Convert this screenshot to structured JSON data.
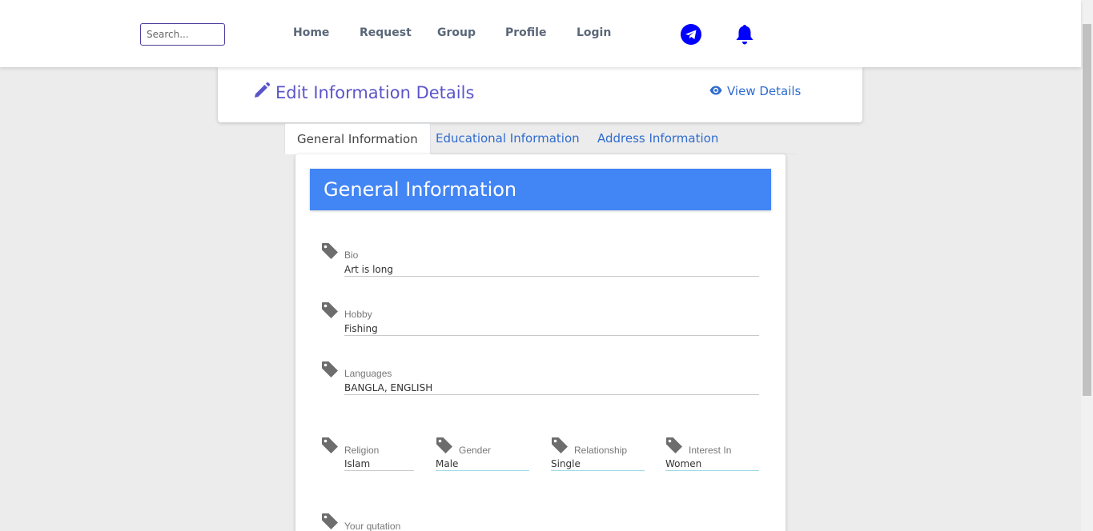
{
  "nav": {
    "search_placeholder": "Search...",
    "links": [
      "Home",
      "Request",
      "Group",
      "Profile",
      "Login"
    ],
    "icons": [
      "telegram-icon",
      "bell-icon"
    ],
    "accent": "#0000ff"
  },
  "header": {
    "title": "Edit Information Details",
    "view_details": "View Details",
    "title_color": "#5b55c9",
    "link_color": "#2f6ccf"
  },
  "tabs": {
    "items": [
      "General Information",
      "Educational Information",
      "Address Information"
    ],
    "active": "General Information"
  },
  "section": {
    "title": "General Information",
    "color": "#4285f4"
  },
  "fields": {
    "bio": {
      "label": "Bio",
      "value": "Art is long"
    },
    "hobby": {
      "label": "Hobby",
      "value": "Fishing"
    },
    "languages": {
      "label": "Languages",
      "value": "BANGLA, ENGLISH"
    },
    "religion": {
      "label": "Religion",
      "value": "Islam"
    },
    "gender": {
      "label": "Gender",
      "value": "Male"
    },
    "relationship": {
      "label": "Relationship",
      "value": "Single"
    },
    "interest": {
      "label": "Interest In",
      "value": "Women"
    },
    "quotation": {
      "label": "Your qutation",
      "value": ""
    }
  }
}
